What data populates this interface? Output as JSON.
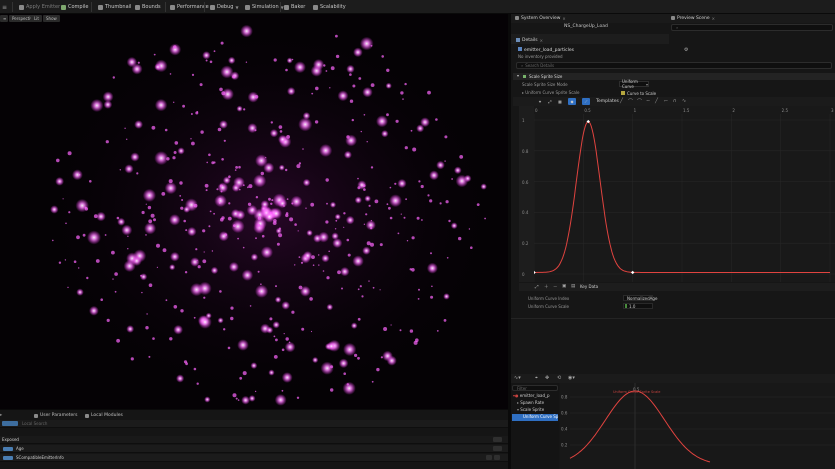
{
  "toolbar": {
    "items": [
      {
        "label": "Apply Emitter",
        "icon": "apply-icon",
        "dim": true
      },
      {
        "label": "Compile",
        "icon": "compile-icon",
        "dim": false
      },
      {
        "label": "Thumbnail",
        "icon": "thumbnail-icon",
        "dim": false
      },
      {
        "label": "Bounds",
        "icon": "bounds-icon",
        "dim": false
      },
      {
        "label": "Performance",
        "icon": "performance-icon",
        "dim": false
      },
      {
        "label": "Debug",
        "icon": "debug-icon",
        "dim": false
      },
      {
        "label": "Simulation",
        "icon": "simulation-icon",
        "dim": false
      },
      {
        "label": "Baker",
        "icon": "baker-icon",
        "dim": false
      },
      {
        "label": "Scalability",
        "icon": "scalability-icon",
        "dim": false
      }
    ]
  },
  "viewport": {
    "mode": "Perspective",
    "lit": "Lit",
    "show": "Show",
    "particle_color": "#ff66ff"
  },
  "bottom_left": {
    "tabs": [
      "User Parameters",
      "Local Modules"
    ],
    "search_placeholder": "Local Search",
    "section_label": "Exposed",
    "row1_label": "Age",
    "row2_label": "SCompatibleEmitterInfo"
  },
  "right": {
    "tabs": {
      "system_overview": "System Overview",
      "asset_title": "NS_ChargeUp_Load",
      "preview": "Preview Scene"
    },
    "details": {
      "tab_label": "Details",
      "emitter_name": "emitter_load_particles",
      "subtitle": "No inventory provided",
      "search_placeholder": "Search Details"
    },
    "module": {
      "title": "Scale Sprite Size",
      "row1_label": "Scale Sprite Size Mode",
      "row1_value": "Uniform Curve",
      "row2_label": "Uniform Curve Sprite Scale",
      "row2_value": "Curve to Scale",
      "templates_label": "Templates",
      "key_data": "Key Data",
      "field1_label": "Uniform Curve Index",
      "field1_value": "NormalizedAge",
      "field2_label": "Uniform Curve Scale",
      "field2_value": "1.0"
    },
    "curve": {
      "x_ticks": [
        "0",
        "0.5",
        "1",
        "1.5",
        "2",
        "2.5",
        "3"
      ],
      "y_ticks": [
        "1",
        "0.8",
        "0.6",
        "0.4",
        "0.2",
        "0"
      ],
      "color": "#e0433f"
    },
    "outliner": {
      "root": "emitter_load_p",
      "items": [
        "Spawn Rate",
        "Scale Sprite",
        "Uniform Curve Sp"
      ],
      "search_placeholder": "Filter"
    },
    "mini_curve": {
      "label": "Uniform Curve Sprite Scale",
      "y_ticks": [
        "0.8",
        "0.6",
        "0.4",
        "0.2"
      ],
      "x_tick": "0.5"
    }
  }
}
